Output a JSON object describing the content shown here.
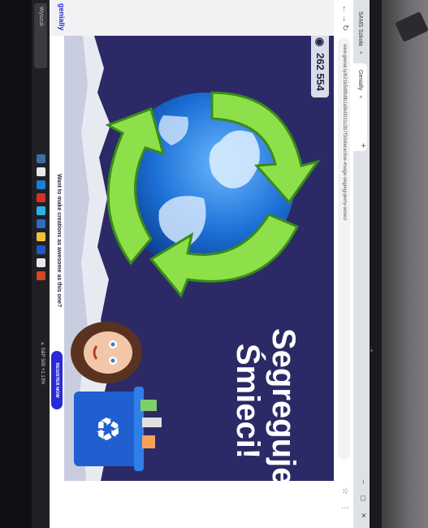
{
  "browser": {
    "tabs": [
      {
        "label": "SAMS Szkoła"
      },
      {
        "label": "Genially"
      }
    ],
    "new_tab_glyph": "+",
    "close_glyph": "×",
    "url": "view.genial.ly/621b5d9b8b1a9e0011c2b7f3/interactive-image-segregujemy-smieci"
  },
  "slide": {
    "title_line1": "Segregujemy",
    "title_line2": "Śmieci!",
    "views_count": "262 554",
    "views_icon": "eye-icon",
    "background_color": "#2b2a66",
    "arrow_color": "#8ee04a",
    "bin_color": "#1f5fd0"
  },
  "promo": {
    "text": "Want to make creations as awesome as this one?",
    "register_label": "REGISTER NOW"
  },
  "brand": {
    "logo_text": "genially"
  },
  "taskbar": {
    "search_placeholder": "Wyszuk",
    "tray_text": "S&P 500 +1.13%"
  }
}
